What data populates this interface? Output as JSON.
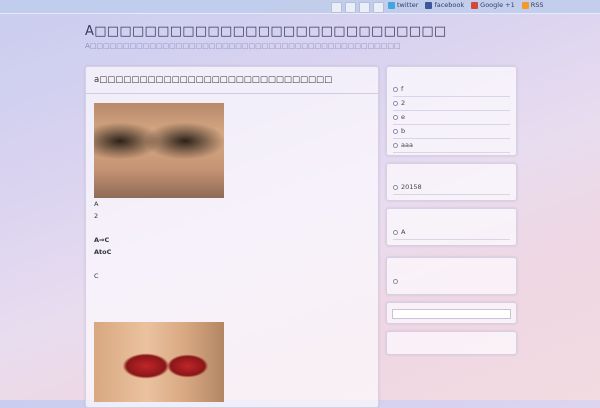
{
  "topbar": {
    "social": [
      {
        "label": "twitter",
        "icon": "twitter-icon"
      },
      {
        "label": "facebook",
        "icon": "facebook-icon"
      },
      {
        "label": "Google +1",
        "icon": "google-plus-icon"
      },
      {
        "label": "RSS",
        "icon": "rss-icon"
      }
    ]
  },
  "header": {
    "title": "A□□□□□□□□□□□□□□□□□□□□□□□□□□□□",
    "description": "A□□□□□□□□□□□□□□□□□□□□□□□□□□□□□□□□□□□□□□□□□□□□□□□"
  },
  "post": {
    "title": "a□□□□□□□□□□□□□□□□□□□□□□□□□□□□□",
    "lines": {
      "l1": "A",
      "l2": "2",
      "l3": "A⇒C",
      "l4": "AtoC",
      "l5": "C"
    }
  },
  "sidebar": {
    "list1": [
      "f",
      "2",
      "e",
      "b",
      "aaa"
    ],
    "list2": [
      "20158"
    ],
    "list3": [
      "A"
    ],
    "list4": [
      ""
    ]
  }
}
